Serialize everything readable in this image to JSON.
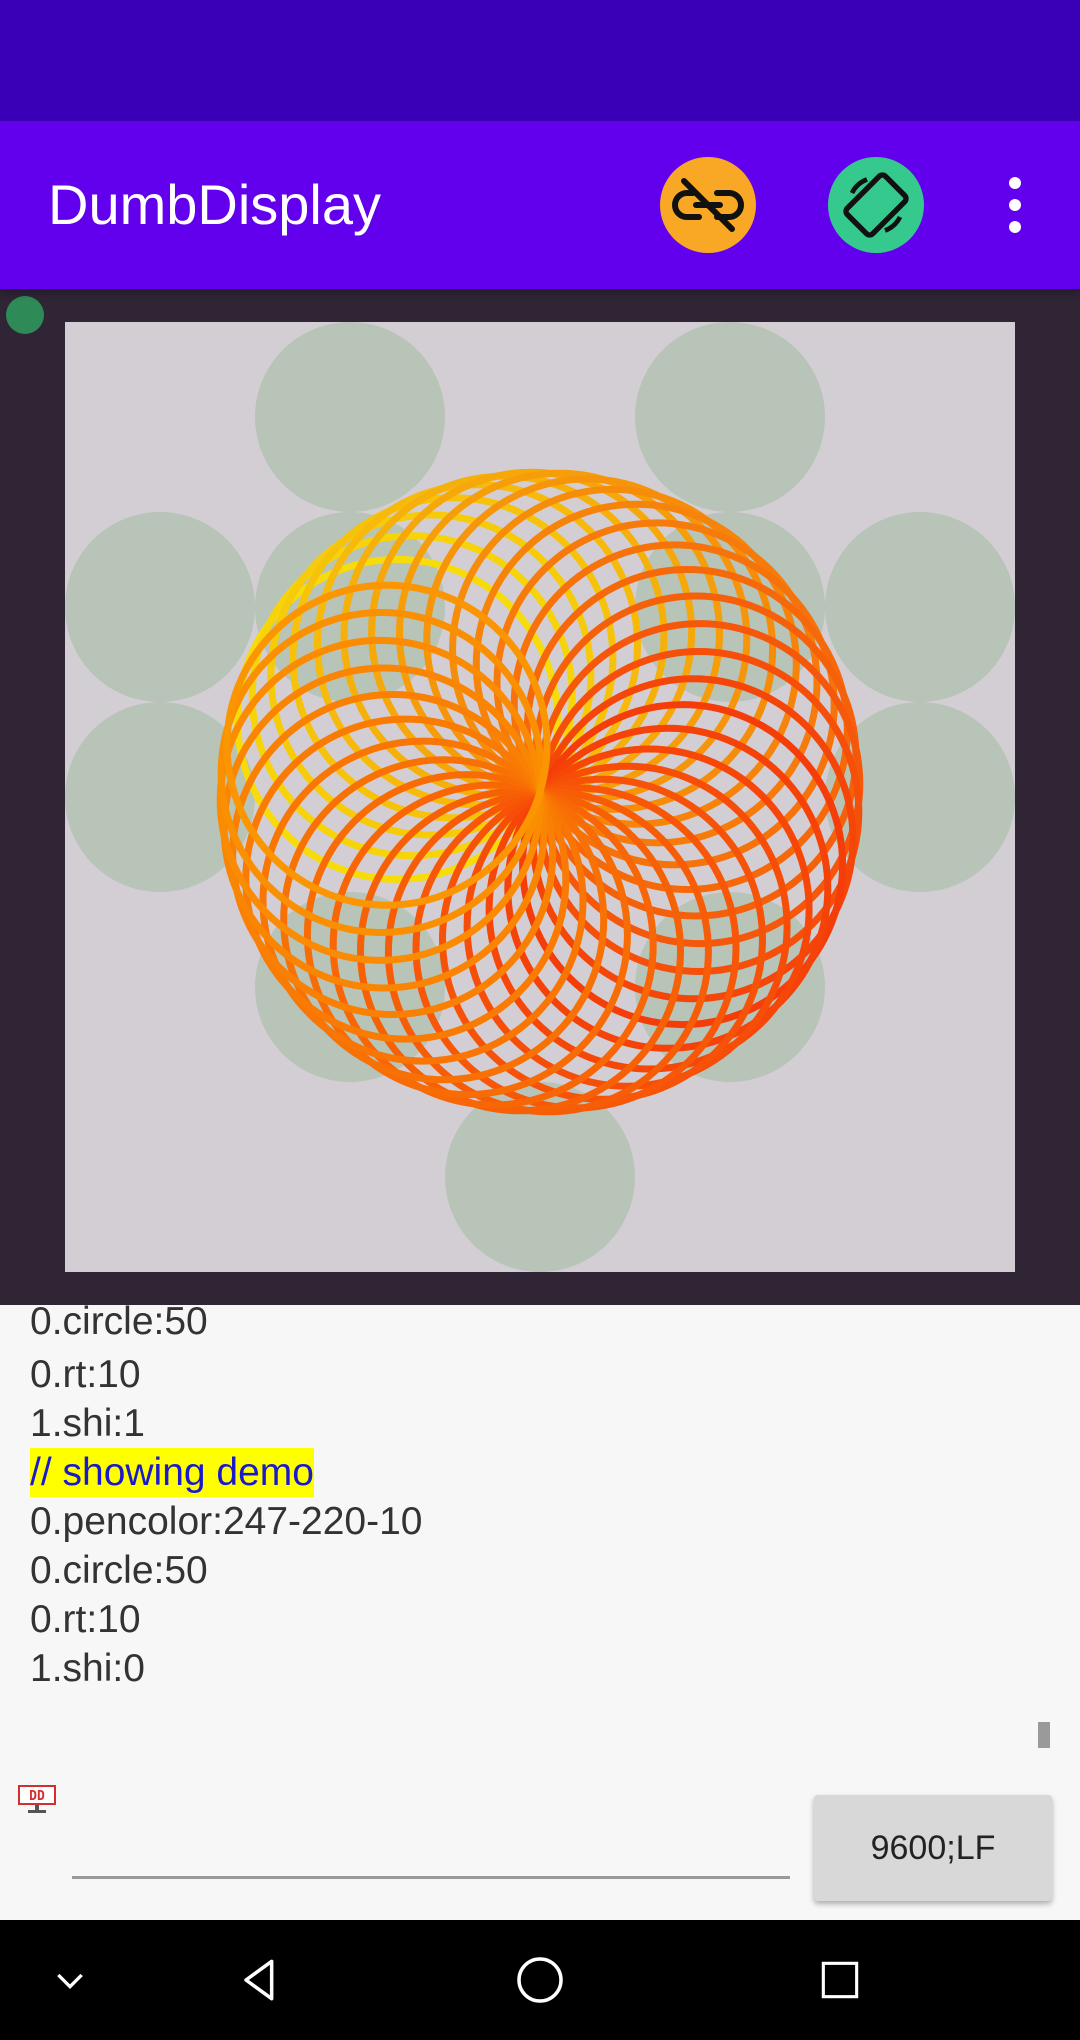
{
  "app": {
    "title": "DumbDisplay",
    "connection_icon": "link-off-icon",
    "rotate_icon": "screen-rotation-icon",
    "menu_icon": "more-vert-icon",
    "status_dot_color": "#2e8b57"
  },
  "canvas": {
    "background": "#d3ced3",
    "circle_color": "#b7c4b7",
    "spiral_colors": [
      "#f7dc0a",
      "#f53d0a",
      "#fb9a00"
    ],
    "spiral_count": 36,
    "spiral_turn_degrees": 10,
    "circle_size": 50
  },
  "log": {
    "lines": [
      {
        "text": "0.circle:50",
        "highlight": false
      },
      {
        "text": "0.rt:10",
        "highlight": false
      },
      {
        "text": "1.shi:1",
        "highlight": false
      },
      {
        "text": "// showing demo",
        "highlight": true
      },
      {
        "text": "0.pencolor:247-220-10",
        "highlight": false
      },
      {
        "text": "0.circle:50",
        "highlight": false
      },
      {
        "text": "0.rt:10",
        "highlight": false
      },
      {
        "text": "1.shi:0",
        "highlight": false
      }
    ]
  },
  "input": {
    "value": "",
    "placeholder": "",
    "send_label": "9600;LF",
    "dd_icon": "dd-logo-icon"
  },
  "navbar": {
    "icons": [
      "chevron-down-icon",
      "back-icon",
      "home-icon",
      "recents-icon"
    ]
  }
}
